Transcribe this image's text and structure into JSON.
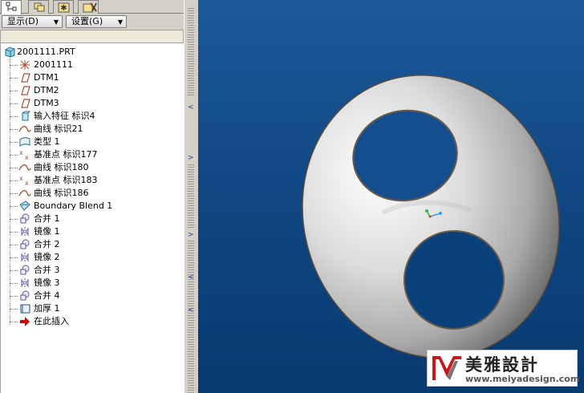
{
  "toolbar": {
    "show_label": "显示(D)",
    "settings_label": "设置(G)"
  },
  "tree": {
    "root": "2001111.PRT",
    "items": [
      {
        "label": "2001111",
        "icon": "csys-icon"
      },
      {
        "label": "DTM1",
        "icon": "datum-plane-icon"
      },
      {
        "label": "DTM2",
        "icon": "datum-plane-icon"
      },
      {
        "label": "DTM3",
        "icon": "datum-plane-icon"
      },
      {
        "label": "输入特征 标识4",
        "icon": "import-feature-icon"
      },
      {
        "label": "曲线 标识21",
        "icon": "curve-icon"
      },
      {
        "label": "类型 1",
        "icon": "surface-icon"
      },
      {
        "label": "基准点 标识177",
        "icon": "datum-point-icon"
      },
      {
        "label": "曲线 标识180",
        "icon": "curve-icon"
      },
      {
        "label": "基准点 标识183",
        "icon": "datum-point-icon"
      },
      {
        "label": "曲线 标识186",
        "icon": "curve-icon"
      },
      {
        "label": "Boundary Blend 1",
        "icon": "boundary-blend-icon"
      },
      {
        "label": "合并 1",
        "icon": "merge-icon"
      },
      {
        "label": "镜像 1",
        "icon": "mirror-icon"
      },
      {
        "label": "合并 2",
        "icon": "merge-icon"
      },
      {
        "label": "镜像 2",
        "icon": "mirror-icon"
      },
      {
        "label": "合并 3",
        "icon": "merge-icon"
      },
      {
        "label": "镜像 3",
        "icon": "mirror-icon"
      },
      {
        "label": "合并 4",
        "icon": "merge-icon"
      },
      {
        "label": "加厚 1",
        "icon": "thicken-icon"
      },
      {
        "label": "在此插入",
        "icon": "insert-here-arrow-icon"
      }
    ]
  },
  "watermark": {
    "brand": "美雅設計",
    "url": "www.meiyadesign.com"
  },
  "colors": {
    "viewport_top": "#1c5a9c",
    "viewport_bottom": "#073a70",
    "insert_arrow": "#cc0000"
  }
}
